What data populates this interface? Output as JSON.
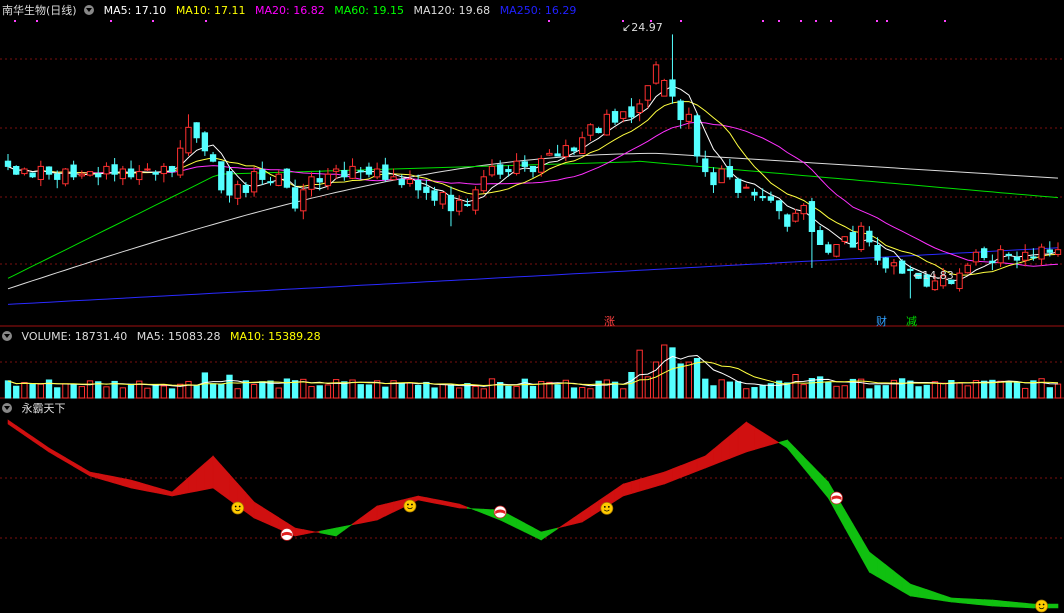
{
  "main_header": {
    "stock_name": "南华生物(日线)",
    "indicators": [
      {
        "label": "MA5: 17.10",
        "color": "#ffffff"
      },
      {
        "label": "MA10: 17.11",
        "color": "#ffff00"
      },
      {
        "label": "MA20: 16.82",
        "color": "#ff00ff"
      },
      {
        "label": "MA60: 19.15",
        "color": "#00ff00"
      },
      {
        "label": "MA120: 19.68",
        "color": "#dddddd"
      },
      {
        "label": "MA250: 16.29",
        "color": "#2020ff"
      }
    ]
  },
  "volume_header": {
    "items": [
      {
        "label": "VOLUME: 18731.40",
        "color": "#dddddd"
      },
      {
        "label": "MA5: 15083.28",
        "color": "#dddddd"
      },
      {
        "label": "MA10: 15389.28",
        "color": "#ffff00"
      }
    ]
  },
  "indicator_header": {
    "title": "永霸天下"
  },
  "annotations": {
    "high_label": "24.97",
    "low_label": "14.83"
  },
  "event_marks": [
    {
      "label": "涨",
      "color": "#ff4040"
    },
    {
      "label": "财",
      "color": "#30a0ff"
    },
    {
      "label": "减",
      "color": "#00dd00"
    }
  ],
  "chart_data": [
    {
      "type": "candlestick",
      "title": "南华生物(日线)",
      "ylim": [
        14.0,
        25.6
      ],
      "highest": 24.97,
      "lowest": 14.83,
      "moving_averages": {
        "MA5": 17.1,
        "MA10": 17.11,
        "MA20": 16.82,
        "MA60": 19.15,
        "MA120": 19.68,
        "MA250": 16.29
      },
      "closes": [
        19.9,
        19.6,
        19.8,
        19.5,
        19.9,
        19.6,
        19.4,
        19.8,
        19.5,
        19.6,
        19.7,
        19.5,
        19.9,
        19.6,
        19.8,
        19.5,
        19.7,
        19.8,
        19.6,
        19.9,
        19.7,
        20.6,
        21.4,
        21.0,
        20.5,
        20.1,
        19.0,
        18.8,
        19.2,
        18.9,
        19.7,
        19.4,
        19.3,
        19.6,
        19.1,
        18.3,
        19.0,
        19.5,
        19.3,
        19.6,
        19.8,
        19.5,
        19.9,
        19.7,
        19.6,
        19.8,
        19.4,
        19.5,
        19.2,
        19.4,
        19.0,
        18.9,
        18.6,
        18.9,
        18.2,
        18.6,
        18.4,
        19.0,
        19.5,
        19.9,
        19.6,
        19.7,
        20.1,
        19.9,
        19.7,
        20.2,
        20.4,
        20.3,
        20.7,
        20.5,
        21.0,
        21.5,
        21.2,
        21.9,
        21.6,
        22.0,
        21.8,
        22.3,
        23.0,
        23.8,
        23.2,
        22.6,
        21.7,
        21.9,
        20.3,
        19.7,
        19.2,
        19.8,
        19.5,
        18.9,
        19.1,
        18.8,
        18.7,
        18.6,
        18.2,
        17.6,
        18.1,
        18.4,
        17.4,
        16.9,
        16.6,
        16.9,
        17.2,
        16.8,
        17.6,
        17.0,
        16.3,
        16.0,
        16.2,
        15.8,
        15.9,
        15.6,
        15.3,
        15.5,
        15.7,
        15.4,
        15.8,
        16.1,
        16.6,
        16.4,
        16.2,
        16.7,
        16.5,
        16.3,
        16.6,
        16.4,
        16.8,
        16.6,
        16.7
      ],
      "max_volume": 46500,
      "volume": {
        "VOLUME": 18731.4,
        "MA5": 15083.28,
        "MA10": 15389.28
      }
    },
    {
      "type": "area",
      "title": "永霸天下",
      "ylim": [
        0,
        100
      ],
      "x": [
        0,
        5,
        10,
        15,
        20,
        25,
        30,
        35,
        40,
        45,
        50,
        55,
        60,
        65,
        70,
        75,
        80,
        85,
        90,
        95,
        100,
        105,
        110,
        115,
        120,
        125,
        130
      ],
      "fast": [
        96,
        82,
        70,
        66,
        60,
        78,
        55,
        42,
        38,
        53,
        58,
        54,
        46,
        36,
        50,
        64,
        70,
        78,
        95,
        82,
        57,
        20,
        8,
        5,
        3,
        2,
        2
      ],
      "slow": [
        94,
        80,
        68,
        62,
        58,
        62,
        47,
        38,
        42,
        46,
        56,
        52,
        51,
        40,
        45,
        58,
        64,
        72,
        80,
        86,
        65,
        30,
        14,
        7,
        6,
        4,
        4
      ],
      "crosses": [
        {
          "x": 28,
          "dir": "up"
        },
        {
          "x": 34,
          "dir": "down"
        },
        {
          "x": 49,
          "dir": "up"
        },
        {
          "x": 60,
          "dir": "down"
        },
        {
          "x": 73,
          "dir": "up"
        },
        {
          "x": 101,
          "dir": "down"
        },
        {
          "x": 126,
          "dir": "up"
        }
      ]
    }
  ]
}
